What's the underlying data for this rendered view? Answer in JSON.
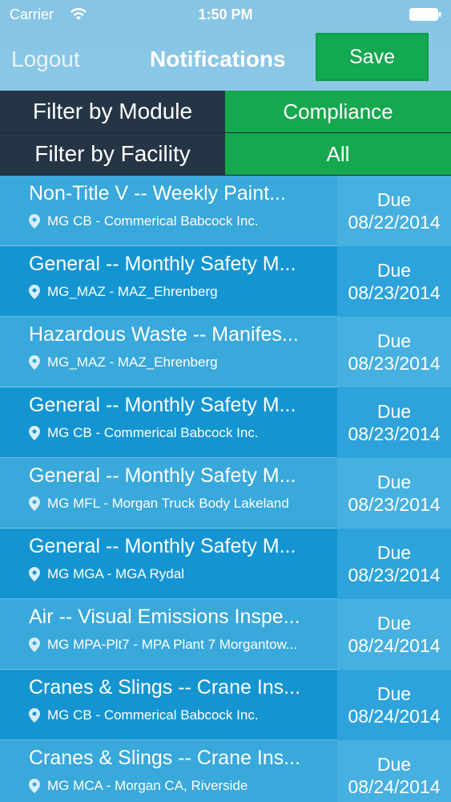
{
  "status_bar": {
    "carrier": "Carrier",
    "time": "1:50 PM"
  },
  "nav": {
    "logout_label": "Logout",
    "title": "Notifications",
    "save_label": "Save"
  },
  "filters": [
    {
      "label": "Filter by Module",
      "value": "Compliance"
    },
    {
      "label": "Filter by Facility",
      "value": "All"
    }
  ],
  "notifications": [
    {
      "title": "Non-Title V -- Weekly Paint...",
      "facility": "MG CB - Commerical Babcock Inc.",
      "due_label": "Due",
      "due_date": "08/22/2014"
    },
    {
      "title": "General -- Monthly Safety M...",
      "facility": "MG_MAZ - MAZ_Ehrenberg",
      "due_label": "Due",
      "due_date": "08/23/2014"
    },
    {
      "title": "Hazardous Waste -- Manifes...",
      "facility": "MG_MAZ - MAZ_Ehrenberg",
      "due_label": "Due",
      "due_date": "08/23/2014"
    },
    {
      "title": "General -- Monthly Safety M...",
      "facility": "MG CB - Commerical Babcock Inc.",
      "due_label": "Due",
      "due_date": "08/23/2014"
    },
    {
      "title": "General -- Monthly Safety M...",
      "facility": "MG MFL - Morgan Truck Body Lakeland",
      "due_label": "Due",
      "due_date": "08/23/2014"
    },
    {
      "title": "General -- Monthly Safety M...",
      "facility": "MG MGA - MGA Rydal",
      "due_label": "Due",
      "due_date": "08/23/2014"
    },
    {
      "title": "Air -- Visual Emissions Inspe...",
      "facility": "MG MPA-Plt7 - MPA Plant 7 Morgantow...",
      "due_label": "Due",
      "due_date": "08/24/2014"
    },
    {
      "title": "Cranes & Slings -- Crane Ins...",
      "facility": "MG CB - Commerical Babcock Inc.",
      "due_label": "Due",
      "due_date": "08/24/2014"
    },
    {
      "title": "Cranes & Slings -- Crane Ins...",
      "facility": "MG MCA - Morgan CA, Riverside",
      "due_label": "Due",
      "due_date": "08/24/2014"
    }
  ],
  "colors": {
    "save_green": "#13a852",
    "filter_dark": "#263545",
    "filter_green": "#15a84f",
    "row_light": "#39a8db",
    "row_dark": "#1495d2"
  },
  "icons": {
    "wifi": "wifi-icon",
    "battery": "battery-icon",
    "location": "location-pin-icon"
  }
}
